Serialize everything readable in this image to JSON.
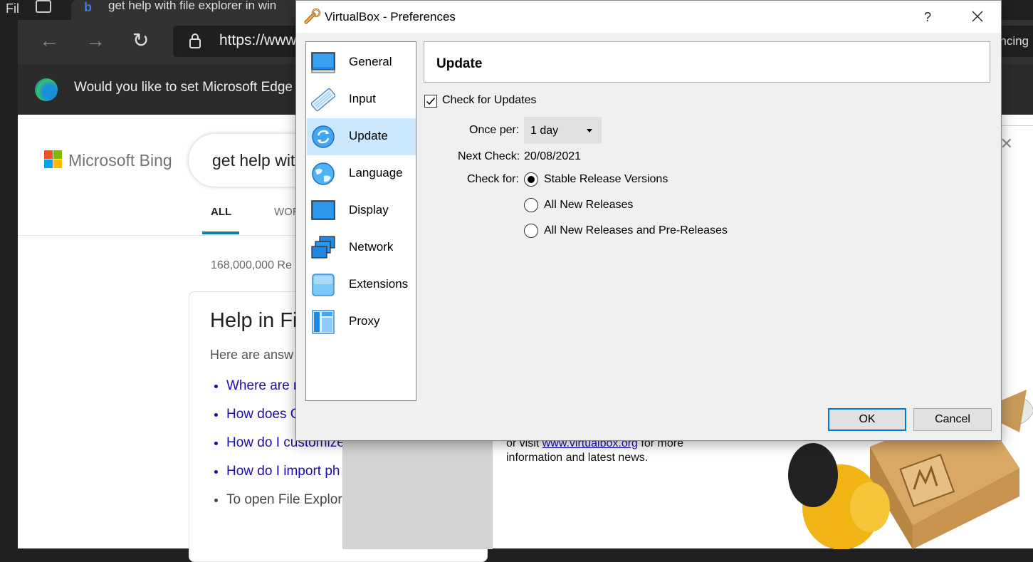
{
  "browser": {
    "app_menu_fragment": "Fil",
    "tab_title": "get help with file explorer in win",
    "url": "https://www",
    "right_fragment": "ncing",
    "notification": "Would you like to set Microsoft Edge"
  },
  "bing": {
    "logo_text": "Microsoft Bing",
    "query": "get help wit",
    "tab_all": "ALL",
    "tab_wor": "WOR",
    "results_count": "168,000,000 Re",
    "card_heading": "Help in Fi",
    "card_sub": "Here are answ",
    "links": [
      "Where are m",
      "How does G",
      "How do I customize",
      "How do I import ph"
    ],
    "plain_bullet": "To open File Explor results."
  },
  "vbox_main": {
    "info_prefix": "or visit ",
    "info_link": "www.virtualbox.org",
    "info_suffix": " for more information and latest news."
  },
  "dialog": {
    "title": "VirtualBox - Preferences",
    "help_label": "?",
    "nav_items": [
      {
        "label": "General",
        "icon": "general-icon"
      },
      {
        "label": "Input",
        "icon": "keyboard-icon"
      },
      {
        "label": "Update",
        "icon": "update-icon",
        "selected": true
      },
      {
        "label": "Language",
        "icon": "globe-icon"
      },
      {
        "label": "Display",
        "icon": "display-icon"
      },
      {
        "label": "Network",
        "icon": "network-icon"
      },
      {
        "label": "Extensions",
        "icon": "extensions-icon"
      },
      {
        "label": "Proxy",
        "icon": "proxy-icon"
      }
    ],
    "page_heading": "Update",
    "check_updates_label": "Check for Updates",
    "check_updates_checked": true,
    "once_per_label": "Once per:",
    "once_per_value": "1 day",
    "next_check_label": "Next Check:",
    "next_check_value": "20/08/2021",
    "check_for_label": "Check for:",
    "check_for_options": [
      {
        "label": "Stable Release Versions",
        "selected": true
      },
      {
        "label": "All New Releases",
        "selected": false
      },
      {
        "label": "All New Releases and Pre-Releases",
        "selected": false
      }
    ],
    "ok_label": "OK",
    "cancel_label": "Cancel"
  },
  "colors": {
    "selection": "#cce8ff",
    "dialog_bg": "#f0f0f0",
    "primary_button_border": "#0078d7",
    "link": "#1a0dab"
  }
}
